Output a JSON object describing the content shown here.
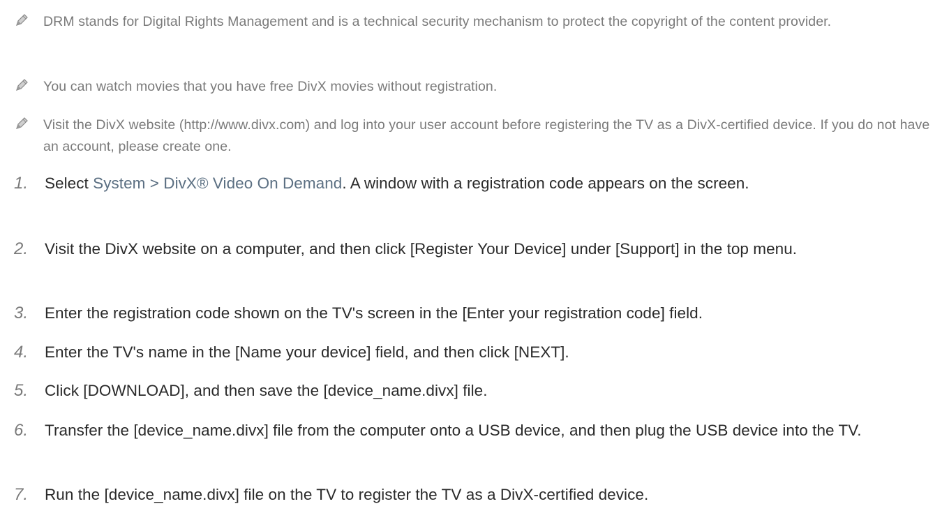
{
  "notes": [
    {
      "text": "DRM stands for Digital Rights Management and is a technical security mechanism to protect the copyright of the content provider."
    },
    {
      "text": "You can watch movies that you have free DivX movies without registration."
    },
    {
      "text": "Visit the DivX website (http://www.divx.com) and log into your user account before registering the TV as a DivX-certified device. If you do not have an account, please create one."
    }
  ],
  "steps": [
    {
      "num": "1.",
      "pre": "Select ",
      "menu1": "System",
      "sep": " > ",
      "menu2": "DivX® Video On Demand",
      "post": ". A window with a registration code appears on the screen."
    },
    {
      "num": "2.",
      "text": "Visit the DivX website on a computer, and then click [Register Your Device] under [Support] in the top menu."
    },
    {
      "num": "3.",
      "text": "Enter the registration code shown on the TV's screen in the [Enter your registration code] field."
    },
    {
      "num": "4.",
      "text": "Enter the TV's name in the [Name your device] field, and then click [NEXT]."
    },
    {
      "num": "5.",
      "text": "Click [DOWNLOAD], and then save the [device_name.divx] file."
    },
    {
      "num": "6.",
      "text": "Transfer the [device_name.divx] file from the computer onto a USB device, and then plug the USB device into the TV."
    },
    {
      "num": "7.",
      "text": "Run the [device_name.divx] file on the TV to register the TV as a DivX-certified device."
    }
  ]
}
